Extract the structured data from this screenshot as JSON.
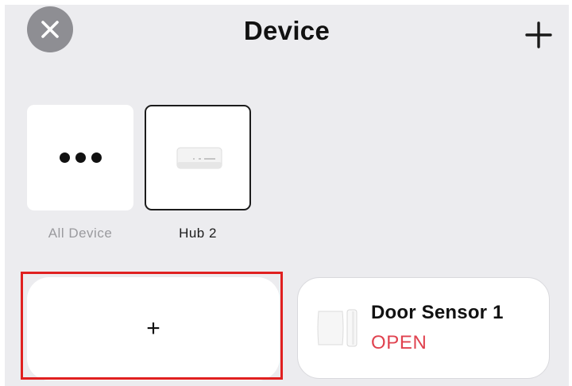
{
  "header": {
    "title": "Device"
  },
  "tiles": [
    {
      "label": "All Device",
      "icon": "more-dots-icon",
      "selected": false
    },
    {
      "label": "Hub 2",
      "icon": "hub-device-icon",
      "selected": true
    }
  ],
  "add_card": {
    "label": "+"
  },
  "sensor_card": {
    "name": "Door Sensor 1",
    "status": "OPEN",
    "status_color": "#e0424f",
    "icon": "door-sensor-icon"
  },
  "colors": {
    "background": "#ececef",
    "close_button": "#8e8e93",
    "highlight": "#e02020"
  }
}
